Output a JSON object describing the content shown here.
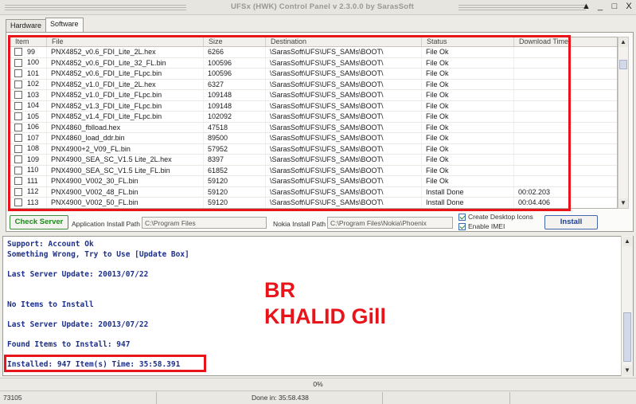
{
  "window": {
    "title": "UFSx (HWK) Control Panel v 2.3.0.0 by SarasSoft",
    "buttons": {
      "help": "▲",
      "minimize": "_",
      "maximize": "□",
      "close": "X"
    }
  },
  "tabs": [
    {
      "label": "Hardware",
      "active": false
    },
    {
      "label": "Software",
      "active": true
    }
  ],
  "grid": {
    "columns": [
      "Item",
      "File",
      "Size",
      "Destination",
      "Status",
      "Download Time"
    ],
    "rows": [
      {
        "item": "99",
        "file": "PNX4852_v0.6_FDI_Lite_2L.hex",
        "size": "6266",
        "dest": "\\SarasSoft\\UFS\\UFS_SAMs\\BOOT\\",
        "status": "File Ok",
        "time": ""
      },
      {
        "item": "100",
        "file": "PNX4852_v0.6_FDI_Lite_32_FL.bin",
        "size": "100596",
        "dest": "\\SarasSoft\\UFS\\UFS_SAMs\\BOOT\\",
        "status": "File Ok",
        "time": ""
      },
      {
        "item": "101",
        "file": "PNX4852_v0.6_FDI_Lite_FLpc.bin",
        "size": "100596",
        "dest": "\\SarasSoft\\UFS\\UFS_SAMs\\BOOT\\",
        "status": "File Ok",
        "time": ""
      },
      {
        "item": "102",
        "file": "PNX4852_v1.0_FDI_Lite_2L.hex",
        "size": "6327",
        "dest": "\\SarasSoft\\UFS\\UFS_SAMs\\BOOT\\",
        "status": "File Ok",
        "time": ""
      },
      {
        "item": "103",
        "file": "PNX4852_v1.0_FDI_Lite_FLpc.bin",
        "size": "109148",
        "dest": "\\SarasSoft\\UFS\\UFS_SAMs\\BOOT\\",
        "status": "File Ok",
        "time": ""
      },
      {
        "item": "104",
        "file": "PNX4852_v1.3_FDI_Lite_FLpc.bin",
        "size": "109148",
        "dest": "\\SarasSoft\\UFS\\UFS_SAMs\\BOOT\\",
        "status": "File Ok",
        "time": ""
      },
      {
        "item": "105",
        "file": "PNX4852_v1.4_FDI_Lite_FLpc.bin",
        "size": "102092",
        "dest": "\\SarasSoft\\UFS\\UFS_SAMs\\BOOT\\",
        "status": "File Ok",
        "time": ""
      },
      {
        "item": "106",
        "file": "PNX4860_fblload.hex",
        "size": "47518",
        "dest": "\\SarasSoft\\UFS\\UFS_SAMs\\BOOT\\",
        "status": "File Ok",
        "time": ""
      },
      {
        "item": "107",
        "file": "PNX4860_load_ddr.bin",
        "size": "89500",
        "dest": "\\SarasSoft\\UFS\\UFS_SAMs\\BOOT\\",
        "status": "File Ok",
        "time": ""
      },
      {
        "item": "108",
        "file": "PNX4900+2_V09_FL.bin",
        "size": "57952",
        "dest": "\\SarasSoft\\UFS\\UFS_SAMs\\BOOT\\",
        "status": "File Ok",
        "time": ""
      },
      {
        "item": "109",
        "file": "PNX4900_SEA_SC_V1.5 Lite_2L.hex",
        "size": "8397",
        "dest": "\\SarasSoft\\UFS\\UFS_SAMs\\BOOT\\",
        "status": "File Ok",
        "time": ""
      },
      {
        "item": "110",
        "file": "PNX4900_SEA_SC_V1.5 Lite_FL.bin",
        "size": "61852",
        "dest": "\\SarasSoft\\UFS\\UFS_SAMs\\BOOT\\",
        "status": "File Ok",
        "time": ""
      },
      {
        "item": "111",
        "file": "PNX4900_V002_30_FL.bin",
        "size": "59120",
        "dest": "\\SarasSoft\\UFS\\UFS_SAMs\\BOOT\\",
        "status": "File Ok",
        "time": ""
      },
      {
        "item": "112",
        "file": "PNX4900_V002_48_FL.bin",
        "size": "59120",
        "dest": "\\SarasSoft\\UFS\\UFS_SAMs\\BOOT\\",
        "status": "Install Done",
        "time": "00:02.203"
      },
      {
        "item": "113",
        "file": "PNX4900_V002_50_FL.bin",
        "size": "59120",
        "dest": "\\SarasSoft\\UFS\\UFS_SAMs\\BOOT\\",
        "status": "Install Done",
        "time": "00:04.406"
      }
    ]
  },
  "controls": {
    "check_server": "Check Server",
    "app_path_label": "Application Install Path",
    "app_path_value": "C:\\Program Files",
    "nokia_path_label": "Nokia Install Path",
    "nokia_path_value": "C:\\Program Files\\Nokia\\Phoenix",
    "create_desktop_icons": "Create Desktop Icons",
    "enable_imei": "Enable IMEI",
    "install": "Install"
  },
  "log": {
    "lines": [
      "Support: Account Ok",
      "Something Wrong, Try to Use [Update Box]",
      "Last Server Update: 20013/07/22",
      "No Items to Install",
      "Last Server Update: 20013/07/22",
      "Found Items to Install: 947",
      "Installed: 947 Item(s) Time: 35:58.391"
    ]
  },
  "overlay": {
    "line1": "BR",
    "line2": "KHALID Gill"
  },
  "progress": {
    "text": "0%",
    "value": 0
  },
  "statusbar": {
    "left": "73105",
    "center": "Done in: 35:58.438"
  },
  "colors": {
    "accent_red": "#e8141a",
    "log_text": "#1c2f8a"
  }
}
